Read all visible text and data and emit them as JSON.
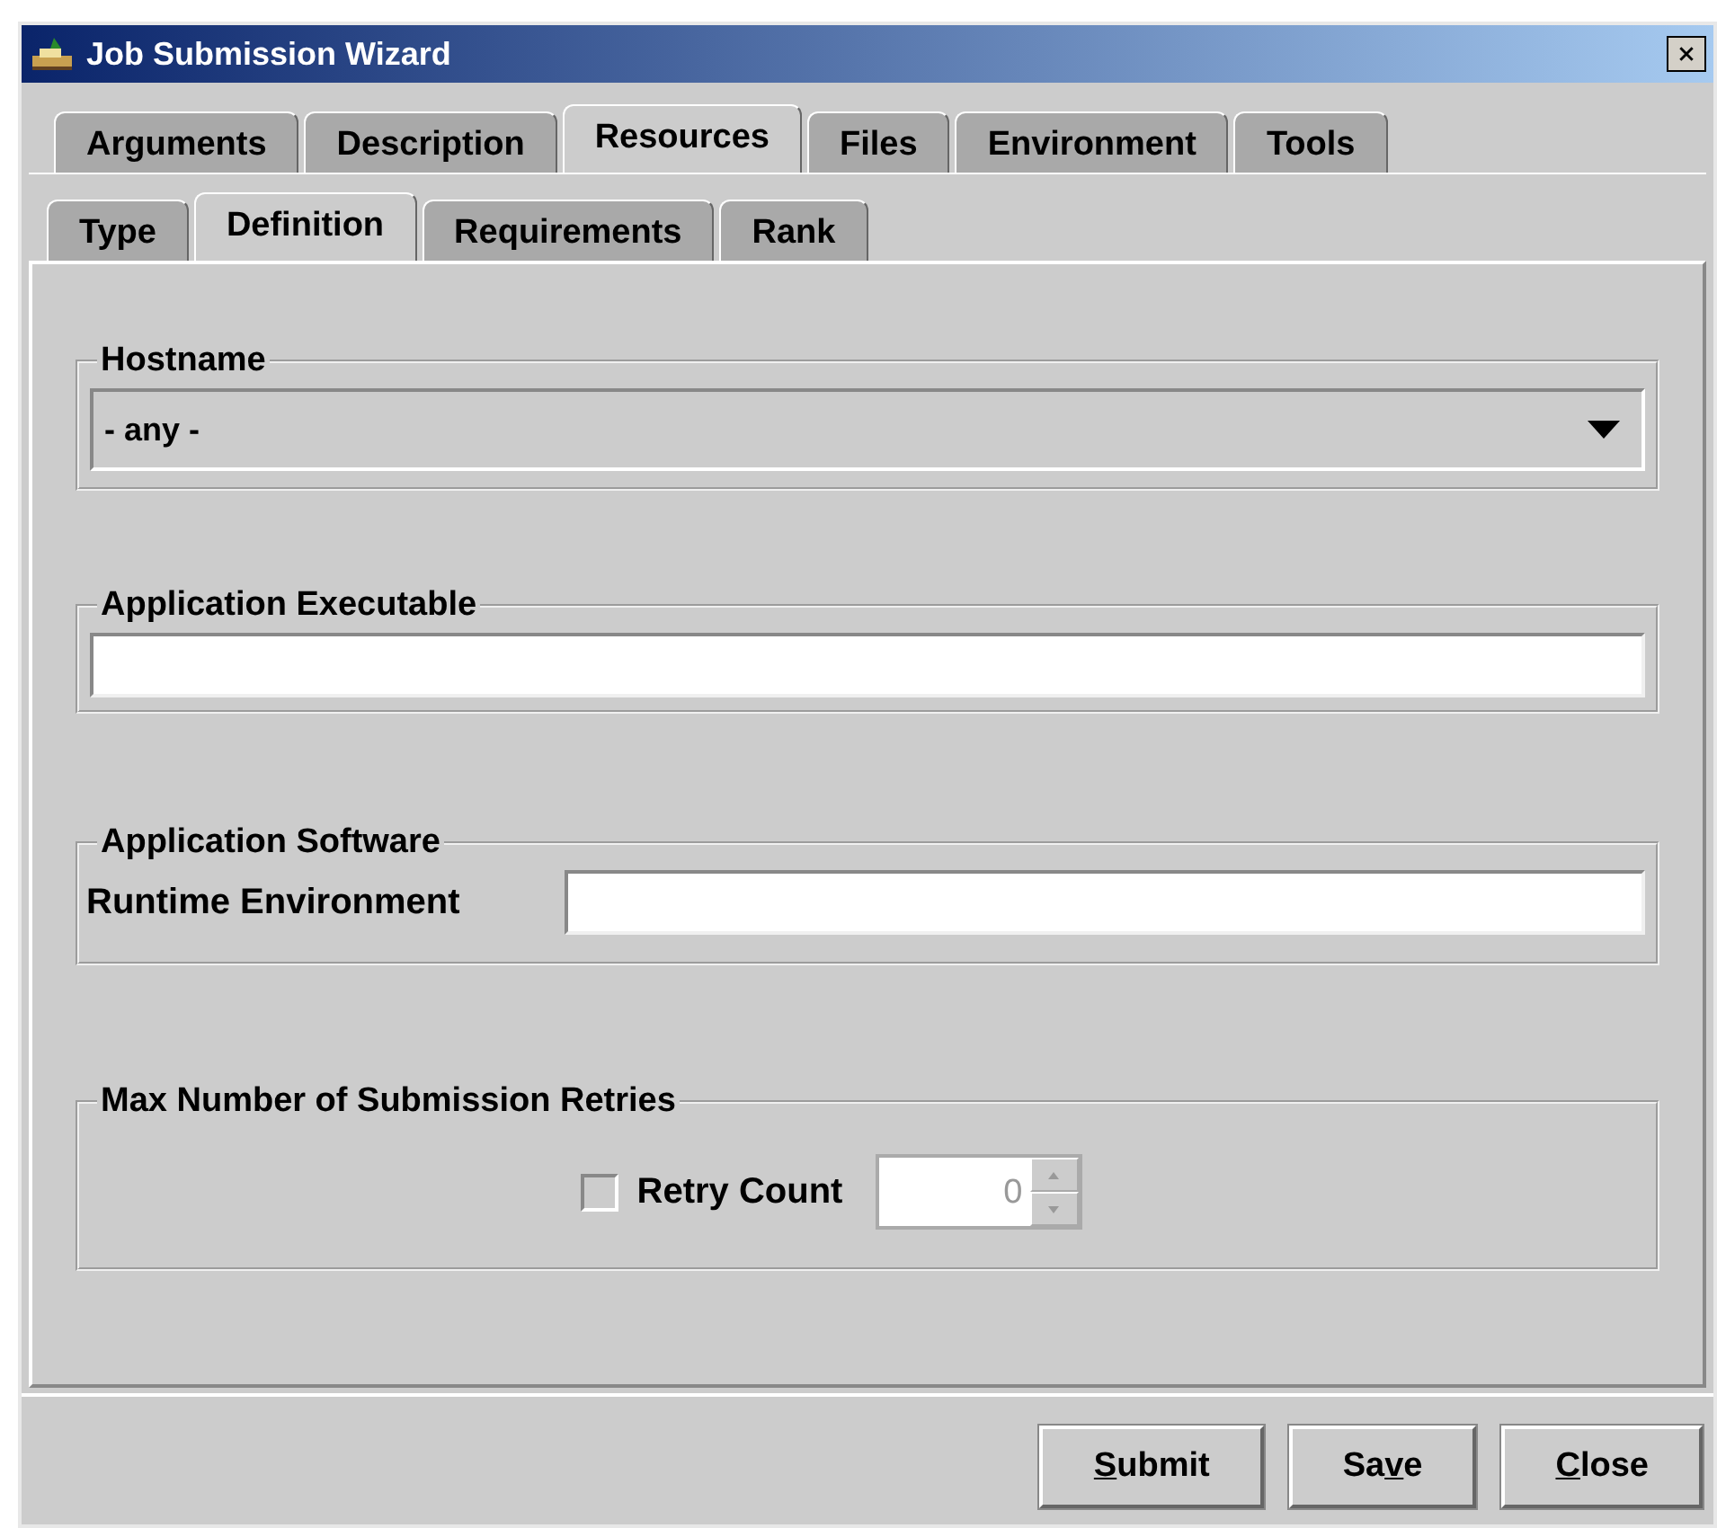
{
  "window": {
    "title": "Job Submission Wizard"
  },
  "tabs": [
    {
      "label": "Arguments",
      "selected": false
    },
    {
      "label": "Description",
      "selected": false
    },
    {
      "label": "Resources",
      "selected": true
    },
    {
      "label": "Files",
      "selected": false
    },
    {
      "label": "Environment",
      "selected": false
    },
    {
      "label": "Tools",
      "selected": false
    }
  ],
  "subtabs": [
    {
      "label": "Type",
      "selected": false
    },
    {
      "label": "Definition",
      "selected": true
    },
    {
      "label": "Requirements",
      "selected": false
    },
    {
      "label": "Rank",
      "selected": false
    }
  ],
  "hostname": {
    "title": "Hostname",
    "value": "- any -"
  },
  "application_executable": {
    "title": "Application Executable"
  },
  "application_software": {
    "title": "Application Software",
    "field_label": "Runtime Environment"
  },
  "retries": {
    "title": "Max Number of Submission Retries",
    "checkbox_label": "Retry Count",
    "checked": false,
    "disabled": true,
    "value": "0"
  },
  "buttons": [
    {
      "mnemonic": "S",
      "after": "ubmit"
    },
    {
      "before": "Sa",
      "mnemonic": "v",
      "after": "e"
    },
    {
      "mnemonic": "C",
      "after": "lose"
    }
  ]
}
